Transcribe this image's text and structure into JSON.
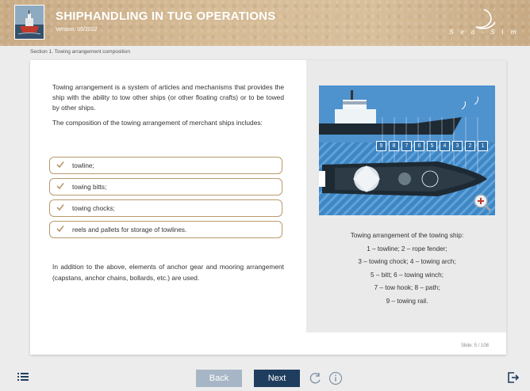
{
  "header": {
    "title": "SHIPHANDLING IN TUG OPERATIONS",
    "version": "Version: 05/2022",
    "brand": "S e a - S i m"
  },
  "section": {
    "label": "Section 1. Towing arrangement composition"
  },
  "content": {
    "intro_1": "Towing arrangement is a system of articles and mechanisms that provides the ship with the ability to tow other ships (or other floating crafts) or to be towed by other ships.",
    "intro_2": "The composition of the towing arrangement of merchant ships includes:",
    "items": [
      {
        "label": "towline;"
      },
      {
        "label": "towing bitts;"
      },
      {
        "label": "towing chocks;"
      },
      {
        "label": "reels and pallets for storage of towlines."
      }
    ],
    "outro": "In addition to the above, elements of anchor gear and mooring arrangement (capstans, anchor chains, bollards, etc.) are used."
  },
  "figure": {
    "labels": [
      "9",
      "8",
      "7",
      "6",
      "5",
      "4",
      "3",
      "2",
      "1"
    ],
    "caption": [
      "Towing arrangement of the towing ship:",
      "1 – towline; 2 – rope fender;",
      "3 – towing chock; 4 – towing arch;",
      "5 – bitt; 6 – towing winch;",
      "7 – tow hook; 8 – path;",
      "9 – towing rail."
    ]
  },
  "footer": {
    "slide_counter": "Slide: 5 / 108",
    "back_label": "Back",
    "next_label": "Next"
  },
  "colors": {
    "header_bg": "#d2b690",
    "next_button": "#1f3d5f",
    "back_button": "#a6b6c6",
    "item_border": "#b99a6f",
    "check": "#b99a6f",
    "diagram_bg": "#4e92ce"
  },
  "icons": {
    "menu": "list-menu-icon",
    "reload": "reload-icon",
    "info": "info-icon",
    "exit": "exit-icon",
    "zoom": "zoom-in-icon",
    "check": "check-icon"
  }
}
